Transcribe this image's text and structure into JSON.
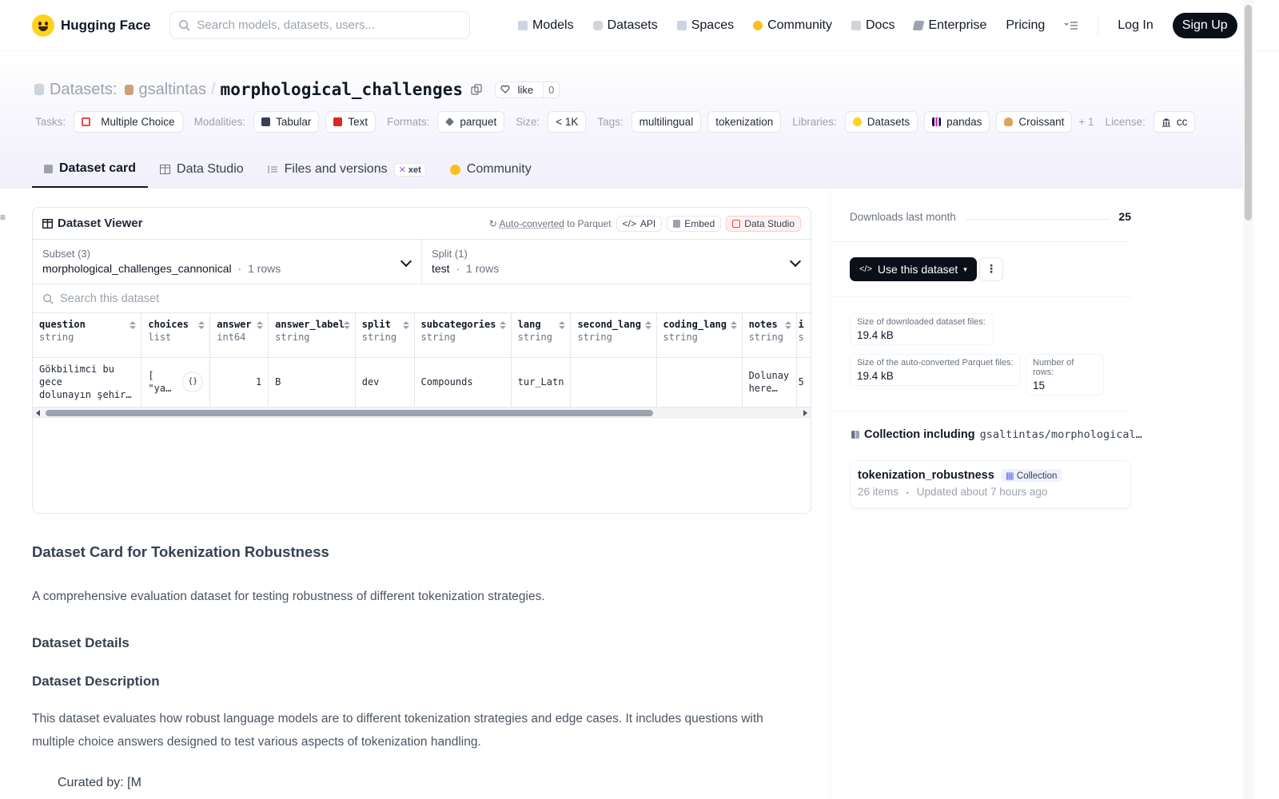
{
  "nav": {
    "brand": "Hugging Face",
    "search_placeholder": "Search models, datasets, users...",
    "links": [
      "Models",
      "Datasets",
      "Spaces",
      "Community",
      "Docs",
      "Enterprise",
      "Pricing"
    ],
    "login": "Log In",
    "signup": "Sign Up"
  },
  "header": {
    "section": "Datasets:",
    "owner": "gsaltintas",
    "separator": "/",
    "name": "morphological_challenges",
    "like_label": "like",
    "like_count": "0"
  },
  "tags": {
    "tasks_label": "Tasks:",
    "tasks": [
      "Multiple Choice"
    ],
    "modalities_label": "Modalities:",
    "modalities": [
      "Tabular",
      "Text"
    ],
    "formats_label": "Formats:",
    "formats": [
      "parquet"
    ],
    "size_label": "Size:",
    "size": "< 1K",
    "tags_label": "Tags:",
    "tags": [
      "multilingual",
      "tokenization"
    ],
    "libraries_label": "Libraries:",
    "libraries": [
      "Datasets",
      "pandas",
      "Croissant"
    ],
    "libraries_more": "+ 1",
    "license_label": "License:",
    "license": "cc"
  },
  "tabs": {
    "dataset_card": "Dataset card",
    "data_studio": "Data Studio",
    "files": "Files and versions",
    "files_badge": "xet",
    "community": "Community"
  },
  "viewer": {
    "title": "Dataset Viewer",
    "auto_converted": "Auto-converted",
    "to_parquet": "to Parquet",
    "api": "API",
    "embed": "Embed",
    "data_studio": "Data Studio",
    "subset_label": "Subset (3)",
    "subset_value": "morphological_challenges_cannonical",
    "subset_rows": "1 rows",
    "split_label": "Split (1)",
    "split_value": "test",
    "split_rows": "1 rows",
    "dot": "·",
    "search_placeholder": "Search this dataset",
    "columns": [
      {
        "name": "question",
        "type": "string"
      },
      {
        "name": "choices",
        "type": "list"
      },
      {
        "name": "answer",
        "type": "int64"
      },
      {
        "name": "answer_label",
        "type": "string"
      },
      {
        "name": "split",
        "type": "string"
      },
      {
        "name": "subcategories",
        "type": "string"
      },
      {
        "name": "lang",
        "type": "string"
      },
      {
        "name": "second_lang",
        "type": "string"
      },
      {
        "name": "coding_lang",
        "type": "string"
      },
      {
        "name": "notes",
        "type": "string"
      },
      {
        "name": "i",
        "type": "s"
      }
    ],
    "row": {
      "question_l1": "Gökbilimci bu gece",
      "question_l2": "dolunayın şehir…",
      "choices_l1": "[",
      "choices_l2": "\"ya…",
      "answer": "1",
      "answer_label": "B",
      "split": "dev",
      "subcategories": "Compounds",
      "lang": "tur_Latn",
      "second_lang": "",
      "coding_lang": "",
      "notes_l1": "Dolunay",
      "notes_l2": "here…",
      "i": "5"
    }
  },
  "card": {
    "title": "Dataset Card for Tokenization Robustness",
    "intro": "A comprehensive evaluation dataset for testing robustness of different tokenization strategies.",
    "details_heading": "Dataset Details",
    "description_heading": "Dataset Description",
    "description": "This dataset evaluates how robust language models are to different tokenization strategies and edge cases. It includes questions with multiple choice answers designed to test various aspects of tokenization handling.",
    "cut_line": "Curated by: [M"
  },
  "sidebar": {
    "downloads_label": "Downloads last month",
    "downloads_value": "25",
    "use_dataset": "Use this dataset",
    "more": "⋮",
    "download_size_label": "Size of downloaded dataset files:",
    "download_size": "19.4 kB",
    "parquet_size_label": "Size of the auto-converted Parquet files:",
    "parquet_size": "19.4 kB",
    "rows_label": "Number of rows:",
    "rows": "15",
    "collection_heading": "Collection including",
    "collection_path": "gsaltintas/morphological…",
    "collection_name": "tokenization_robustness",
    "collection_badge": "Collection",
    "collection_items": "26 items",
    "collection_updated": "Updated about 7 hours ago",
    "meta_dot": "•"
  },
  "colors": {
    "accent_dark": "#0b0f19",
    "hf_yellow": "#ffd21e",
    "red_icon": "#ef4444"
  }
}
